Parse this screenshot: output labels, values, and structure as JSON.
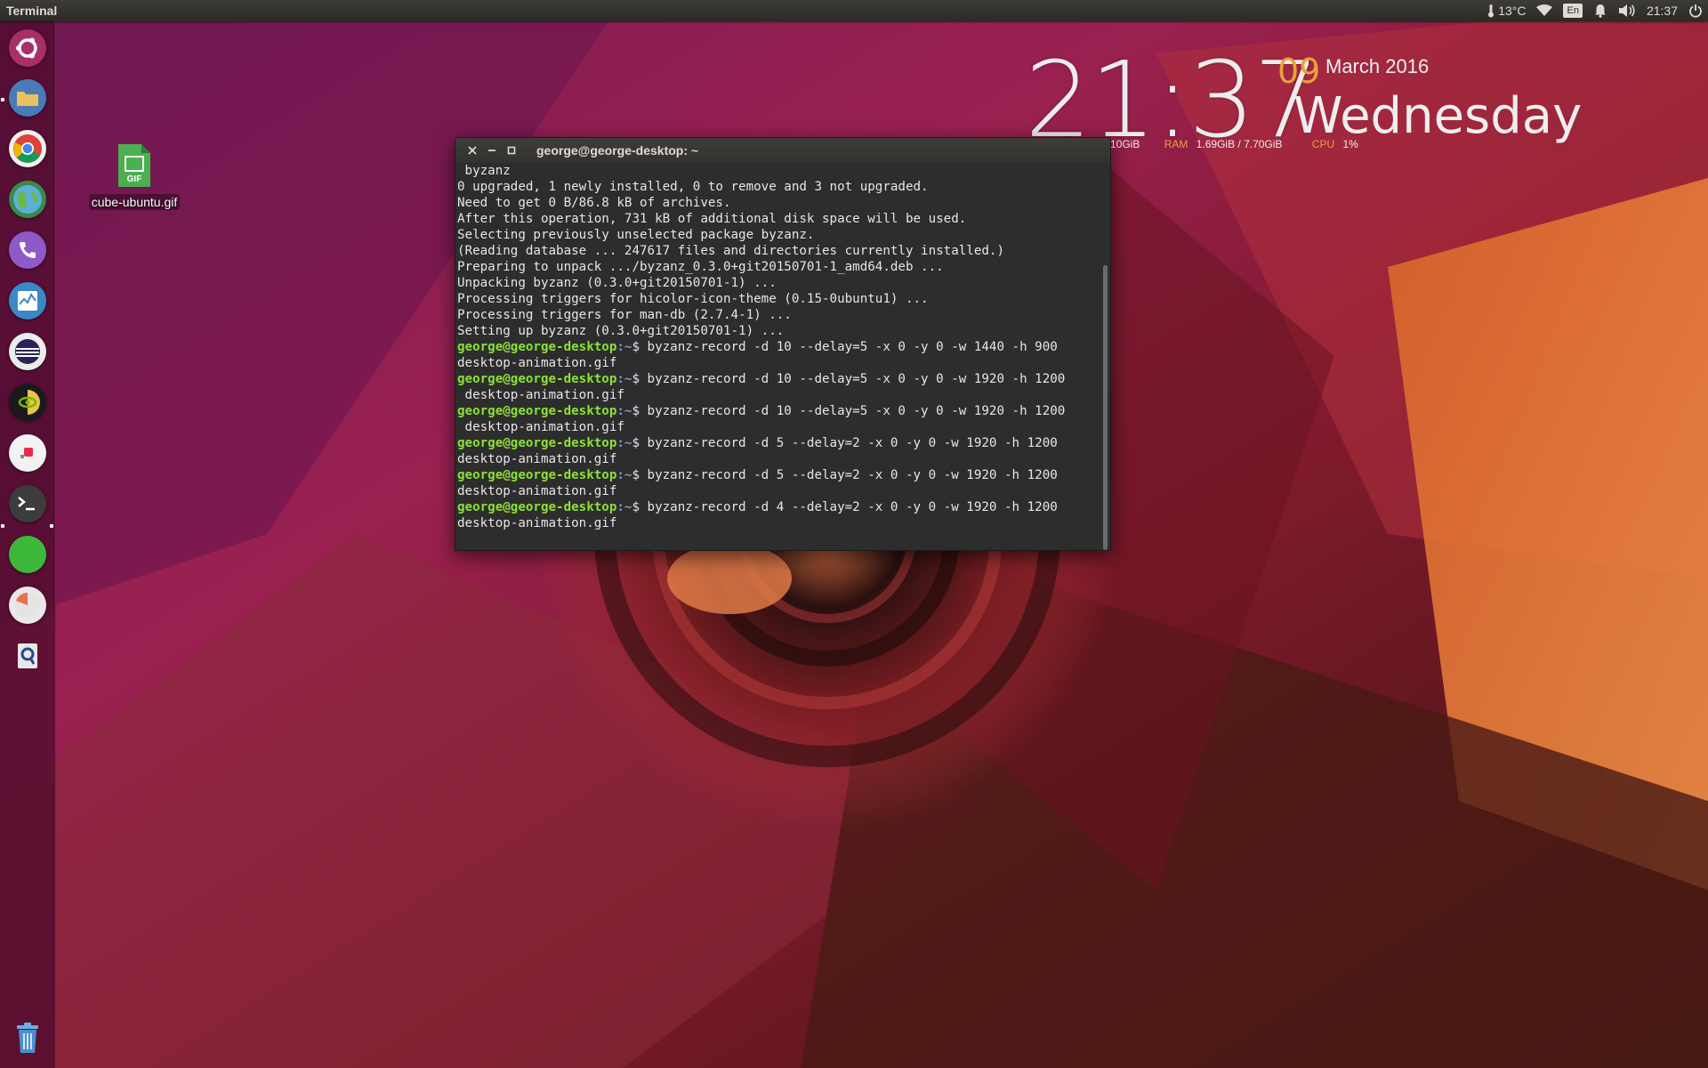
{
  "top_panel": {
    "active_app": "Terminal",
    "temperature": "13°C",
    "language": "En",
    "time": "21:37"
  },
  "launcher": {
    "items": [
      {
        "name": "Search your computer",
        "icon": "ubuntu-dash-icon"
      },
      {
        "name": "Files",
        "icon": "files-icon"
      },
      {
        "name": "Google Chrome",
        "icon": "chrome-icon"
      },
      {
        "name": "Earth",
        "icon": "globe-icon"
      },
      {
        "name": "Viber",
        "icon": "phone-icon"
      },
      {
        "name": "System Monitor",
        "icon": "system-monitor-icon"
      },
      {
        "name": "Eclipse",
        "icon": "eclipse-icon"
      },
      {
        "name": "NVIDIA Settings",
        "icon": "nvidia-icon"
      },
      {
        "name": "Recorder",
        "icon": "recorder-icon"
      },
      {
        "name": "Terminal",
        "icon": "terminal-icon"
      },
      {
        "name": "Green App",
        "icon": "green-circle-icon"
      },
      {
        "name": "Disk Usage",
        "icon": "pie-icon"
      },
      {
        "name": "Keyring",
        "icon": "keyring-icon"
      },
      {
        "name": "Trash",
        "icon": "trash-icon"
      }
    ]
  },
  "desktop": {
    "file_label": "cube-ubuntu.gif",
    "file_badge": "GIF"
  },
  "conky": {
    "time": "21:37",
    "day": "09",
    "month_year": "March 2016",
    "weekday": "Wednesday",
    "disk_value": "10GiB",
    "ram_label": "RAM",
    "ram_value": "1.69GiB / 7.70GiB",
    "cpu_label": "CPU",
    "cpu_value": "1%"
  },
  "terminal": {
    "title": "george@george-desktop: ~",
    "prompt_user": "george@george-desktop",
    "prompt_path": ":~",
    "lines": [
      " byzanz",
      "0 upgraded, 1 newly installed, 0 to remove and 3 not upgraded.",
      "Need to get 0 B/86.8 kB of archives.",
      "After this operation, 731 kB of additional disk space will be used.",
      "Selecting previously unselected package byzanz.",
      "(Reading database ... 247617 files and directories currently installed.)",
      "Preparing to unpack .../byzanz_0.3.0+git20150701-1_amd64.deb ...",
      "Unpacking byzanz (0.3.0+git20150701-1) ...",
      "Processing triggers for hicolor-icon-theme (0.15-0ubuntu1) ...",
      "Processing triggers for man-db (2.7.4-1) ...",
      "Setting up byzanz (0.3.0+git20150701-1) ..."
    ],
    "commands": [
      {
        "cmd": "$ byzanz-record -d 10 --delay=5 -x 0 -y 0 -w 1440 -h 900",
        "out": "desktop-animation.gif"
      },
      {
        "cmd": "$ byzanz-record -d 10 --delay=5 -x 0 -y 0 -w 1920 -h 1200",
        "out": " desktop-animation.gif"
      },
      {
        "cmd": "$ byzanz-record -d 10 --delay=5 -x 0 -y 0 -w 1920 -h 1200",
        "out": " desktop-animation.gif"
      },
      {
        "cmd": "$ byzanz-record -d 5 --delay=2 -x 0 -y 0 -w 1920 -h 1200",
        "out": "desktop-animation.gif"
      },
      {
        "cmd": "$ byzanz-record -d 5 --delay=2 -x 0 -y 0 -w 1920 -h 1200",
        "out": "desktop-animation.gif"
      },
      {
        "cmd": "$ byzanz-record -d 4 --delay=2 -x 0 -y 0 -w 1920 -h 1200",
        "out": "desktop-animation.gif"
      }
    ]
  },
  "colors": {
    "prompt_user": "#8ae234",
    "prompt_path": "#729fcf",
    "conky_accent": "#e9a23b"
  }
}
